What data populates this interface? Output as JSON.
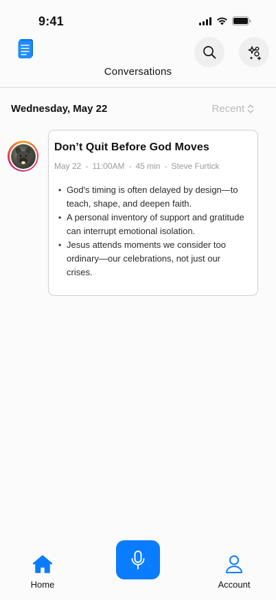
{
  "status_bar": {
    "time": "9:41"
  },
  "header": {
    "title": "Conversations"
  },
  "section": {
    "date": "Wednesday, May 22",
    "sort_label": "Recent"
  },
  "conversation": {
    "title": "Don’t Quit Before God Moves",
    "date": "May 22",
    "time": "11:00AM",
    "duration": "45 min",
    "speaker": "Steve Furtick",
    "separator": "-",
    "bullets": [
      "God's timing is often delayed by design—to teach, shape, and deepen faith.",
      "A personal inventory of support and gratitude can interrupt emotional isolation.",
      "Jesus attends moments we consider too ordinary—our celebrations, not just our crises."
    ]
  },
  "nav": {
    "home_label": "Home",
    "account_label": "Account"
  },
  "colors": {
    "accent": "#0a7cff",
    "muted": "#9a9a9a"
  },
  "icons": [
    "app-logo-icon",
    "search-icon",
    "sparkles-icon",
    "home-icon",
    "microphone-icon",
    "account-icon"
  ]
}
